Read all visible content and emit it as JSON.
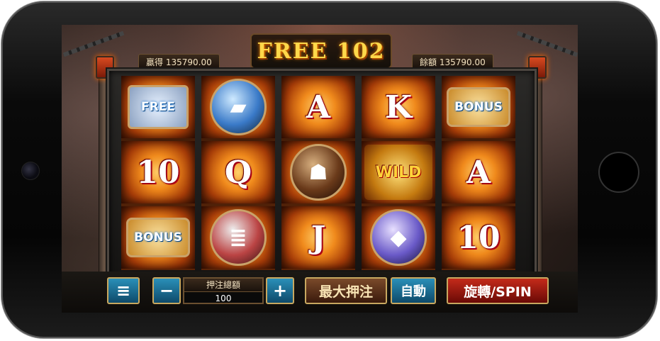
{
  "header": {
    "free_label": "FREE 102",
    "win_label": "贏得 135790.00",
    "balance_label": "餘額 135790.00"
  },
  "reels": [
    [
      "FREE",
      "10",
      "BONUS"
    ],
    [
      "icon-book",
      "Q",
      "icon-scroll"
    ],
    [
      "A",
      "icon-idol",
      "J"
    ],
    [
      "K",
      "WILD",
      "icon-crystal"
    ],
    [
      "BONUS",
      "A",
      "10"
    ]
  ],
  "controls": {
    "menu_icon": "≡",
    "minus_label": "−",
    "bet_label": "押注總額",
    "bet_value": "100",
    "plus_label": "+",
    "max_bet_label": "最大押注",
    "auto_label": "自動",
    "spin_label": "旋轉/SPIN"
  },
  "colors": {
    "gold": "#ffd84a",
    "button_blue": "#2a8fb8",
    "button_red": "#c42a1a"
  }
}
